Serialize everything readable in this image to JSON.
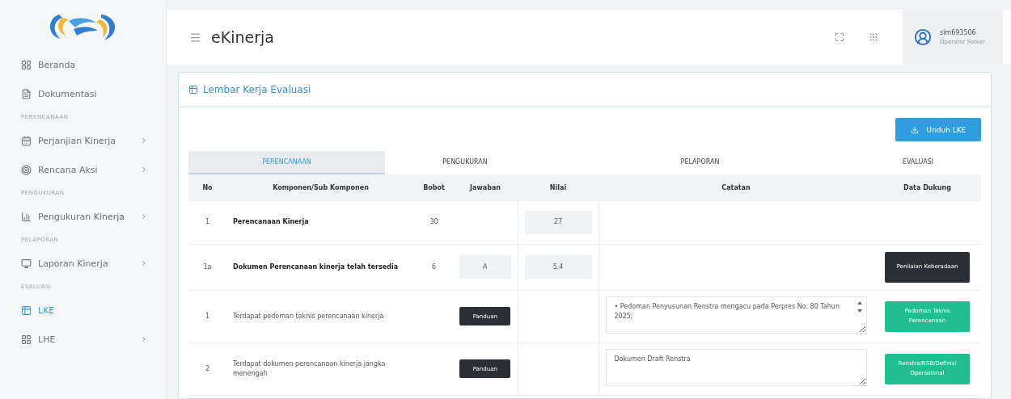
{
  "sidebar": {
    "items": [
      {
        "kind": "item",
        "label": "Beranda",
        "selected": false,
        "expandable": false
      },
      {
        "kind": "item",
        "label": "Dokumentasi",
        "selected": false,
        "expandable": false
      },
      {
        "kind": "section",
        "label": "PERENCANAAN"
      },
      {
        "kind": "item",
        "label": "Perjanjian Kinerja",
        "selected": false,
        "expandable": true
      },
      {
        "kind": "item",
        "label": "Rencana Aksi",
        "selected": false,
        "expandable": true
      },
      {
        "kind": "section",
        "label": "PENGUKURAN"
      },
      {
        "kind": "item",
        "label": "Pengukuran Kinerja",
        "selected": false,
        "expandable": true
      },
      {
        "kind": "section",
        "label": "PELAPORAN"
      },
      {
        "kind": "item",
        "label": "Laporan Kinerja",
        "selected": false,
        "expandable": true
      },
      {
        "kind": "section",
        "label": "EVALUASI"
      },
      {
        "kind": "item",
        "label": "LKE",
        "selected": true,
        "expandable": false
      },
      {
        "kind": "item",
        "label": "LHE",
        "selected": false,
        "expandable": true
      }
    ]
  },
  "header": {
    "title": "eKinerja",
    "user": {
      "name": "sim693506",
      "role": "Operator Satker"
    }
  },
  "card": {
    "title": "Lembar Kerja Evaluasi",
    "download_button": "Unduh LKE",
    "tabs": [
      {
        "label": "PERENCANAAN",
        "selected": true
      },
      {
        "label": "PENGUKURAN",
        "selected": false
      },
      {
        "label": "PELAPORAN",
        "selected": false
      },
      {
        "label": "EVALUASI",
        "selected": false
      }
    ],
    "table": {
      "columns": [
        "No",
        "Komponen/Sub Komponen",
        "Bobot",
        "Jawaban",
        "Nilai",
        "Catatan",
        "Data Dukung"
      ],
      "rows": [
        {
          "kind": "component",
          "no": "1",
          "name": "Perencanaan Kinerja",
          "bobot": "30",
          "nilai": "27"
        },
        {
          "kind": "sub",
          "no": "1a",
          "name": "Dokumen Perencanaan kinerja telah tersedia",
          "bobot": "6",
          "jawaban": "A",
          "nilai": "5.4",
          "support_button": {
            "label": "Penilaian Keberadaan",
            "color": "#2b2f36"
          }
        },
        {
          "kind": "criterion",
          "no": "1",
          "name": "Terdapat pedoman teknis perencanaan kinerja",
          "guide_button": "Panduan",
          "note": "• Pedoman Penyusunan Renstra mengacu pada Perpres No. 80 Tahun 2025;",
          "note_scroll": true,
          "support_button": {
            "label": "Pedoman Teknis Perencanaan",
            "color": "#1fbf8f"
          }
        },
        {
          "kind": "criterion",
          "no": "2",
          "name": "Terdapat dokumen perencanaan kinerja jangka menengah",
          "guide_button": "Panduan",
          "note": "Dokumen Draft Renstra",
          "note_scroll": false,
          "support_button": {
            "label": "Renstra/RSB/Definisi Operasional",
            "color": "#1fbf8f"
          }
        }
      ]
    }
  }
}
